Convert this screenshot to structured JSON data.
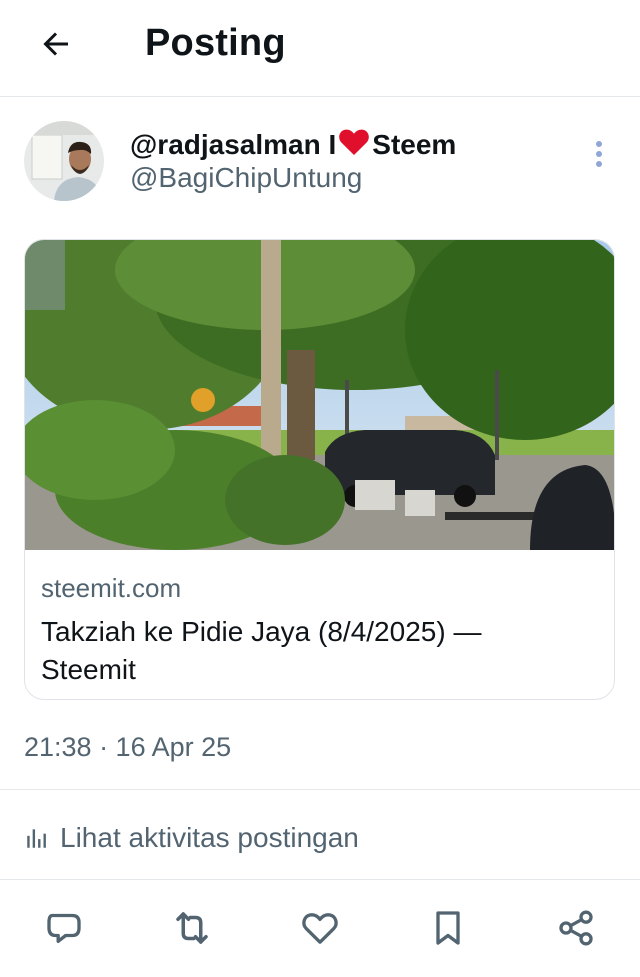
{
  "header": {
    "title": "Posting",
    "back_icon": "arrow-left-icon"
  },
  "author": {
    "name_part1": "@radjasalman I",
    "name_emoji": "heart-icon",
    "name_part2": "Steem",
    "handle": "@BagiChipUntung"
  },
  "link_card": {
    "domain": "steemit.com",
    "title": "Takziah ke Pidie Jaya (8/4/2025) — Steemit"
  },
  "timestamp": "21:38 · 16 Apr 25",
  "activity_label": "Lihat aktivitas postingan",
  "actions": [
    "reply-icon",
    "repost-icon",
    "like-icon",
    "bookmark-icon",
    "share-icon"
  ],
  "colors": {
    "text": "#0f1419",
    "secondary": "#536471",
    "divider": "#e6e9ec",
    "heart": "#e0102d",
    "more_dots": "#8fa6d6"
  }
}
